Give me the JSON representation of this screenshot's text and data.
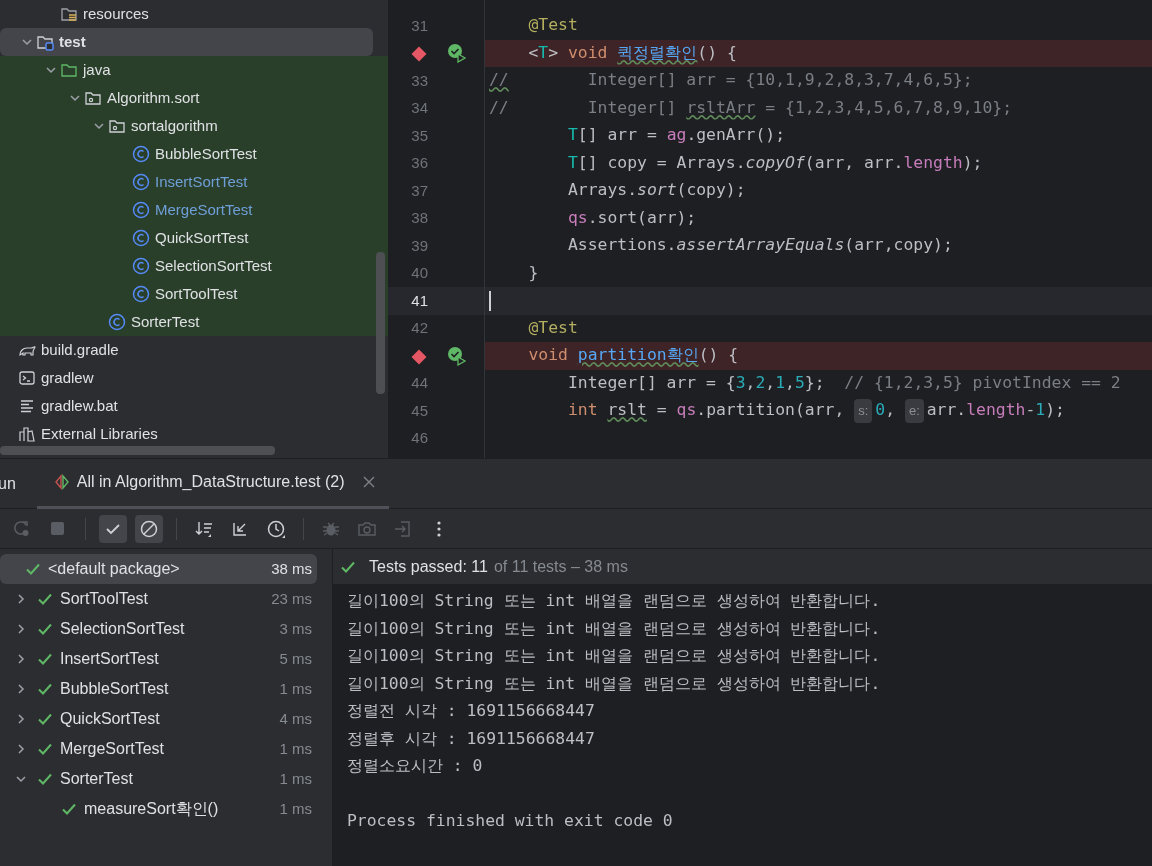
{
  "project_tree": [
    {
      "children": [
        {
          "children": [
            {
              "children": [
                {
                  "label": "resources",
                  "kind": "resources",
                  "selected": false,
                  "scoped": false,
                  "modified": false
                }
              ]
            },
            {
              "label": "test",
              "kind": "test-folder",
              "expanded": true,
              "selected": true,
              "scoped": false,
              "modified": false,
              "children": [
                {
                  "label": "java",
                  "kind": "source-folder",
                  "expanded": true,
                  "selected": false,
                  "scoped": true,
                  "modified": false,
                  "children": [
                    {
                      "label": "Algorithm.sort",
                      "kind": "package",
                      "expanded": true,
                      "selected": false,
                      "scoped": true,
                      "modified": false,
                      "children": [
                        {
                          "label": "sortalgorithm",
                          "kind": "package",
                          "expanded": true,
                          "selected": false,
                          "scoped": true,
                          "modified": false,
                          "children": [
                            {
                              "label": "BubbleSortTest",
                              "kind": "class",
                              "selected": false,
                              "scoped": true,
                              "modified": false
                            },
                            {
                              "label": "InsertSortTest",
                              "kind": "class",
                              "selected": false,
                              "scoped": true,
                              "modified": true
                            },
                            {
                              "label": "MergeSortTest",
                              "kind": "class",
                              "selected": false,
                              "scoped": true,
                              "modified": true
                            },
                            {
                              "label": "QuickSortTest",
                              "kind": "class",
                              "selected": false,
                              "scoped": true,
                              "modified": false
                            },
                            {
                              "label": "SelectionSortTest",
                              "kind": "class",
                              "selected": false,
                              "scoped": true,
                              "modified": false
                            },
                            {
                              "label": "SortToolTest",
                              "kind": "class",
                              "selected": false,
                              "scoped": true,
                              "modified": false
                            }
                          ]
                        },
                        {
                          "label": "SorterTest",
                          "kind": "class",
                          "selected": false,
                          "scoped": true,
                          "modified": false
                        }
                      ]
                    }
                  ]
                }
              ]
            }
          ]
        },
        {
          "label": "build.gradle",
          "kind": "gradle",
          "selected": false,
          "scoped": false,
          "modified": false
        },
        {
          "label": "gradlew",
          "kind": "terminal",
          "selected": false,
          "scoped": false,
          "modified": false
        },
        {
          "label": "gradlew.bat",
          "kind": "text-file",
          "selected": false,
          "scoped": false,
          "modified": false
        }
      ]
    },
    {
      "label": "External Libraries",
      "kind": "library",
      "selected": false,
      "scoped": false,
      "modified": false
    }
  ],
  "editor": {
    "lines": [
      {
        "number": "31",
        "breakpoint": false,
        "run_marker": false,
        "current": false,
        "tokens": [
          {
            "t": "    @Test",
            "kind": "annotation"
          }
        ]
      },
      {
        "breakpoint": true,
        "run_marker": true,
        "current": false,
        "tokens": [
          {
            "t": "    <"
          },
          {
            "t": "T",
            "kind": "type-param"
          },
          {
            "t": "> "
          },
          {
            "t": "void ",
            "kind": "keyword"
          },
          {
            "t": "퀵정렬확인",
            "kind": "declaration"
          },
          {
            "t": "() {"
          }
        ]
      },
      {
        "number": "33",
        "breakpoint": false,
        "run_marker": false,
        "current": false,
        "tokens": [
          {
            "t": "//",
            "kind": "comment-typo"
          },
          {
            "t": "        Integer[] arr = {10,1,9,2,8,3,7,4,6,5};",
            "kind": "comment"
          }
        ]
      },
      {
        "number": "34",
        "breakpoint": false,
        "run_marker": false,
        "current": false,
        "tokens": [
          {
            "t": "//        Integer[] ",
            "kind": "comment"
          },
          {
            "t": "rsltArr",
            "kind": "comment-typo"
          },
          {
            "t": " = {1,2,3,4,5,6,7,8,9,10};",
            "kind": "comment"
          }
        ]
      },
      {
        "number": "35",
        "breakpoint": false,
        "run_marker": false,
        "current": false,
        "tokens": [
          {
            "t": "        T",
            "kind": "type-param"
          },
          {
            "t": "[] arr = "
          },
          {
            "t": "ag",
            "kind": "field"
          },
          {
            "t": ".genArr();"
          }
        ]
      },
      {
        "number": "36",
        "breakpoint": false,
        "run_marker": false,
        "current": false,
        "tokens": [
          {
            "t": "        T",
            "kind": "type-param"
          },
          {
            "t": "[] copy = Arrays."
          },
          {
            "t": "copyOf",
            "kind": "static"
          },
          {
            "t": "(arr, arr."
          },
          {
            "t": "length",
            "kind": "field"
          },
          {
            "t": ");"
          }
        ]
      },
      {
        "number": "37",
        "breakpoint": false,
        "run_marker": false,
        "current": false,
        "tokens": [
          {
            "t": "        Arrays."
          },
          {
            "t": "sort",
            "kind": "static"
          },
          {
            "t": "(copy);"
          }
        ]
      },
      {
        "number": "38",
        "breakpoint": false,
        "run_marker": false,
        "current": false,
        "tokens": [
          {
            "t": "        qs",
            "kind": "field"
          },
          {
            "t": ".sort(arr);"
          }
        ]
      },
      {
        "number": "39",
        "breakpoint": false,
        "run_marker": false,
        "current": false,
        "tokens": [
          {
            "t": "        Assertions."
          },
          {
            "t": "assertArrayEquals",
            "kind": "static"
          },
          {
            "t": "(arr,copy);"
          }
        ]
      },
      {
        "number": "40",
        "breakpoint": false,
        "run_marker": false,
        "current": false,
        "tokens": [
          {
            "t": "    }"
          }
        ]
      },
      {
        "number": "41",
        "breakpoint": false,
        "run_marker": false,
        "current": true
      },
      {
        "number": "42",
        "breakpoint": false,
        "run_marker": false,
        "current": false,
        "tokens": [
          {
            "t": "    @Test",
            "kind": "annotation"
          }
        ]
      },
      {
        "breakpoint": true,
        "run_marker": true,
        "current": false,
        "tokens": [
          {
            "t": "    void ",
            "kind": "keyword"
          },
          {
            "t": "partition확인",
            "kind": "declaration"
          },
          {
            "t": "() {"
          }
        ]
      },
      {
        "number": "44",
        "breakpoint": false,
        "run_marker": false,
        "current": false,
        "tokens": [
          {
            "t": "        Integer[] arr = {"
          },
          {
            "t": "3",
            "kind": "number"
          },
          {
            "t": ","
          },
          {
            "t": "2",
            "kind": "number"
          },
          {
            "t": ","
          },
          {
            "t": "1",
            "kind": "number"
          },
          {
            "t": ","
          },
          {
            "t": "5",
            "kind": "number"
          },
          {
            "t": "};  "
          },
          {
            "t": "// {1,2,3,5} pivotIndex == 2",
            "kind": "comment"
          }
        ]
      },
      {
        "number": "45",
        "breakpoint": false,
        "run_marker": false,
        "current": false,
        "tokens": [
          {
            "t": "        int ",
            "kind": "keyword"
          },
          {
            "t": "rslt",
            "kind": "typo"
          },
          {
            "t": " = "
          },
          {
            "t": "qs",
            "kind": "field"
          },
          {
            "t": ".partition(arr, "
          },
          {
            "t": "s:",
            "kind": "hint"
          },
          {
            "t": "0",
            "kind": "number"
          },
          {
            "t": ", "
          },
          {
            "t": "e:",
            "kind": "hint"
          },
          {
            "t": "arr."
          },
          {
            "t": "length",
            "kind": "field"
          },
          {
            "t": "-"
          },
          {
            "t": "1",
            "kind": "number"
          },
          {
            "t": ");"
          }
        ]
      },
      {
        "number": "46",
        "breakpoint": false,
        "run_marker": false,
        "current": false
      }
    ]
  },
  "run_window": {
    "title": "un",
    "tabs": [
      {
        "label": "All in Algorithm_DataStructure.test (2)",
        "selected": true
      }
    ],
    "toolbar": [
      [
        {
          "kind": "rerun",
          "disabled": true,
          "on": false
        },
        {
          "kind": "stop",
          "disabled": true,
          "on": false
        }
      ],
      [
        {
          "kind": "show-passed",
          "disabled": false,
          "on": true
        },
        {
          "kind": "show-ignored",
          "disabled": false,
          "on": true
        }
      ],
      [
        {
          "kind": "sort",
          "disabled": false,
          "on": false
        },
        {
          "kind": "collapse",
          "disabled": false,
          "on": false
        },
        {
          "kind": "duration",
          "disabled": false,
          "on": false
        }
      ],
      [
        {
          "kind": "bug",
          "disabled": true,
          "on": false
        },
        {
          "kind": "camera",
          "disabled": true,
          "on": false
        },
        {
          "kind": "export",
          "disabled": true,
          "on": false
        },
        {
          "kind": "more",
          "disabled": false,
          "on": false
        }
      ]
    ],
    "tests": [
      {
        "label": "<default package>",
        "time": "38 ms",
        "passed": true,
        "selected": true,
        "children": [
          {
            "label": "SortToolTest",
            "time": "23 ms",
            "passed": true,
            "selected": false,
            "expanded": false
          },
          {
            "label": "SelectionSortTest",
            "time": "3 ms",
            "passed": true,
            "selected": false,
            "expanded": false
          },
          {
            "label": "InsertSortTest",
            "time": "5 ms",
            "passed": true,
            "selected": false,
            "expanded": false
          },
          {
            "label": "BubbleSortTest",
            "time": "1 ms",
            "passed": true,
            "selected": false,
            "expanded": false
          },
          {
            "label": "QuickSortTest",
            "time": "4 ms",
            "passed": true,
            "selected": false,
            "expanded": false
          },
          {
            "label": "MergeSortTest",
            "time": "1 ms",
            "passed": true,
            "selected": false,
            "expanded": false
          },
          {
            "label": "SorterTest",
            "time": "1 ms",
            "passed": true,
            "selected": false,
            "expanded": true,
            "children": [
              {
                "label": "measureSort확인()",
                "time": "1 ms",
                "passed": true,
                "selected": false
              }
            ]
          }
        ]
      }
    ],
    "summary": {
      "passed": true,
      "label": "Tests passed: 11",
      "detail": "of 11 tests – 38 ms"
    },
    "console": [
      "길이100의 String 또는 int 배열을 랜덤으로 생성하여 반환합니다.",
      "길이100의 String 또는 int 배열을 랜덤으로 생성하여 반환합니다.",
      "길이100의 String 또는 int 배열을 랜덤으로 생성하여 반환합니다.",
      "길이100의 String 또는 int 배열을 랜덤으로 생성하여 반환합니다.",
      "정렬전 시각 : 1691156668447",
      "정렬후 시각 : 1691156668447",
      "정렬소요시간 : 0"
    ],
    "exit_message": "Process finished with exit code 0"
  }
}
